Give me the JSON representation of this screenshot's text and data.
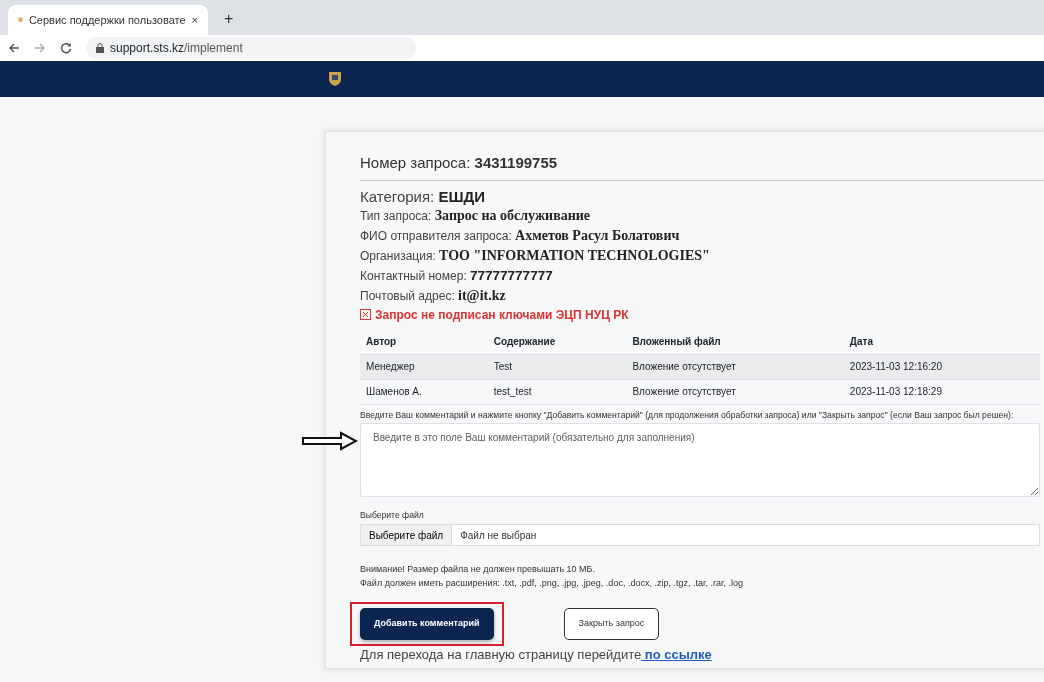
{
  "browser": {
    "tab_title": "Сервис поддержки пользовате",
    "close": "×",
    "new_tab": "+",
    "url_host": "support.sts.kz",
    "url_path": "/implement"
  },
  "request": {
    "number_label": "Номер запроса:",
    "number": "3431199755",
    "fields": [
      {
        "label": "Категория:",
        "value": "ЕШДИ"
      },
      {
        "label": "Тип запроса:",
        "value": "Запрос на обслуживание"
      },
      {
        "label": "ФИО отправителя запроса:",
        "value": "Ахметов Расул Болатович"
      },
      {
        "label": "Организация:",
        "value": "ТОО \"INFORMATION TECHNOLOGIES\""
      },
      {
        "label": "Контактный номер:",
        "value": "77777777777"
      },
      {
        "label": "Почтовый адрес:",
        "value": "it@it.kz"
      }
    ],
    "signature_warning": "Запрос не подписан ключами ЭЦП НУЦ РК"
  },
  "table": {
    "columns": [
      "Автор",
      "Содержание",
      "Вложенный файл",
      "Дата"
    ],
    "rows": [
      [
        "Менеджер",
        "Test",
        "Вложение отсутствует",
        "2023-11-03 12:16:20"
      ],
      [
        "Шаменов А.",
        "test_test",
        "Вложение отсутствует",
        "2023-11-03 12:18:29"
      ]
    ]
  },
  "comment": {
    "label": "Введите Ваш комментарий и нажмите кнопку \"Добавить комментарий\" (для продолжения обработки запроса) или \"Закрыть запрос\" (если Ваш запрос был решен):",
    "placeholder": "Введите в это поле Ваш комментарий (обязательно для заполнения)"
  },
  "file": {
    "label": "Выберите файл",
    "button": "Выберите файл",
    "status": "Файл не выбран"
  },
  "notes": [
    "Внимание! Размер файла не должен превышать 10 МБ.",
    "Файл должен иметь расширения: .txt, .pdf, .png, .jpg, .jpeg, .doc, .docx, .zip, .tgz, .tar, .rar, .log"
  ],
  "buttons": [
    {
      "kind": "primary",
      "label": "Добавить комментарий",
      "highlighted": true
    },
    {
      "kind": "outline",
      "label": "Закрыть запрос",
      "highlighted": false
    }
  ],
  "footer": {
    "text": "Для перехода на главную страницу перейдите",
    "link": " по ссылке"
  },
  "annotation_arrow": true
}
